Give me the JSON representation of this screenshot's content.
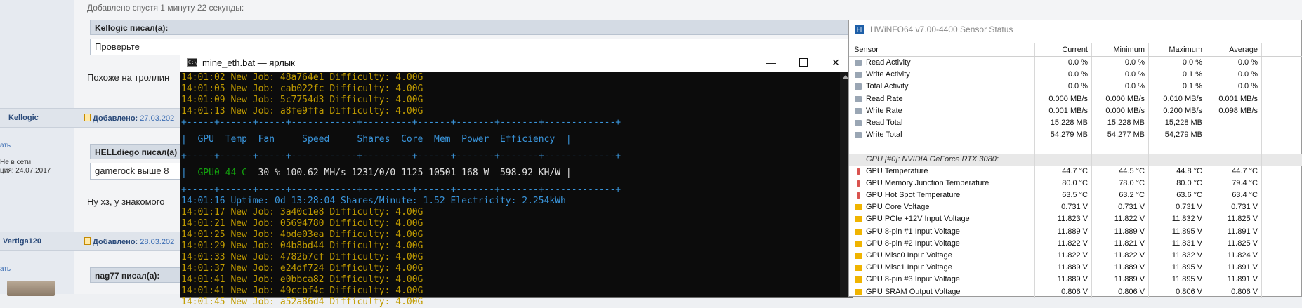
{
  "forum": {
    "added_top": "Добавлено спустя 1 минуту 22 секунды:",
    "quote1_author": "Kellogic писал(а):",
    "quote1_text": "Проверьте",
    "reply1_text": "Похоже на троллин",
    "post2_user": "Kellogic",
    "post2_added": "Добавлено:",
    "post2_date": "27.03.202",
    "post2_link": "ать",
    "post2_status": "Не в сети",
    "post2_reg": "ция: 24.07.2017",
    "quote2_author": "HELLdiego писал(а)",
    "quote2_text": "gamerock выше 8",
    "reply2_text": "Ну хз, у знакомого",
    "post3_user": "Vertiga120",
    "post3_added": "Добавлено:",
    "post3_date": "28.03.202",
    "post3_link": "ать",
    "quote3_author": "nag77 писал(а):"
  },
  "cmd": {
    "title": "mine_eth.bat — ярлык",
    "icon_label": "C:\\",
    "min_glyph": "—",
    "close_glyph": "✕",
    "lines_before": [
      "14:01:02 New Job: 48a764e1 Difficulty: 4.00G",
      "14:01:05 New Job: cab022fc Difficulty: 4.00G",
      "14:01:09 New Job: 5c7754d3 Difficulty: 4.00G",
      "14:01:13 New Job: a8fe9ffa Difficulty: 4.00G"
    ],
    "separator": "+-----+------+-----+------------+---------+------+-------+-------+-------------+",
    "header_row": "|  GPU  Temp  Fan     Speed     Shares  Core  Mem  Power  Efficiency  |",
    "gpu_row_prefix": "|  ",
    "gpu_row_name": "GPU0 44 C",
    "gpu_row_rest": "  30 % 100.62 MH/s 1231/0/0 1125 10501 168 W  598.92 KH/W |",
    "uptime": "14:01:16 Uptime: 0d 13:28:04 Shares/Minute: 1.52 Electricity: 2.254kWh",
    "lines_after": [
      "14:01:17 New Job: 3a40c1e8 Difficulty: 4.00G",
      "14:01:21 New Job: 05694780 Difficulty: 4.00G",
      "14:01:25 New Job: 4bde03ea Difficulty: 4.00G",
      "14:01:29 New Job: 04b8bd44 Difficulty: 4.00G",
      "14:01:33 New Job: 4782b7cf Difficulty: 4.00G",
      "14:01:37 New Job: e24df724 Difficulty: 4.00G",
      "14:01:41 New Job: e0bbca82 Difficulty: 4.00G",
      "14:01:41 New Job: 49ccbf4c Difficulty: 4.00G",
      "14:01:45 New Job: a52a86d4 Difficulty: 4.00G"
    ]
  },
  "hwinfo": {
    "title": "HWiNFO64 v7.00-4400 Sensor Status",
    "icon_label": "HI",
    "min_glyph": "—",
    "columns": [
      "Sensor",
      "Current",
      "Minimum",
      "Maximum",
      "Average"
    ],
    "rows": [
      {
        "name": "Read Activity",
        "cur": "0.0 %",
        "min": "0.0 %",
        "max": "0.0 %",
        "avg": "0.0 %",
        "icon": "disk"
      },
      {
        "name": "Write Activity",
        "cur": "0.0 %",
        "min": "0.0 %",
        "max": "0.1 %",
        "avg": "0.0 %",
        "icon": "disk"
      },
      {
        "name": "Total Activity",
        "cur": "0.0 %",
        "min": "0.0 %",
        "max": "0.1 %",
        "avg": "0.0 %",
        "icon": "disk"
      },
      {
        "name": "Read Rate",
        "cur": "0.000 MB/s",
        "min": "0.000 MB/s",
        "max": "0.010 MB/s",
        "avg": "0.001 MB/s",
        "icon": "disk"
      },
      {
        "name": "Write Rate",
        "cur": "0.001 MB/s",
        "min": "0.000 MB/s",
        "max": "0.200 MB/s",
        "avg": "0.098 MB/s",
        "icon": "disk"
      },
      {
        "name": "Read Total",
        "cur": "15,228 MB",
        "min": "15,228 MB",
        "max": "15,228 MB",
        "avg": "",
        "icon": "disk"
      },
      {
        "name": "Write Total",
        "cur": "54,279 MB",
        "min": "54,277 MB",
        "max": "54,279 MB",
        "avg": "",
        "icon": "disk"
      },
      {
        "name": "",
        "cur": "",
        "min": "",
        "max": "",
        "avg": "",
        "icon": ""
      },
      {
        "name": "GPU [#0]: NVIDIA GeForce RTX 3080:",
        "cur": "",
        "min": "",
        "max": "",
        "avg": "",
        "icon": "section"
      },
      {
        "name": "GPU Temperature",
        "cur": "44.7 °C",
        "min": "44.5 °C",
        "max": "44.8 °C",
        "avg": "44.7 °C",
        "icon": "temp"
      },
      {
        "name": "GPU Memory Junction Temperature",
        "cur": "80.0 °C",
        "min": "78.0 °C",
        "max": "80.0 °C",
        "avg": "79.4 °C",
        "icon": "temp"
      },
      {
        "name": "GPU Hot Spot Temperature",
        "cur": "63.5 °C",
        "min": "63.2 °C",
        "max": "63.6 °C",
        "avg": "63.4 °C",
        "icon": "temp"
      },
      {
        "name": "GPU Core Voltage",
        "cur": "0.731 V",
        "min": "0.731 V",
        "max": "0.731 V",
        "avg": "0.731 V",
        "icon": "volt"
      },
      {
        "name": "GPU PCIe +12V Input Voltage",
        "cur": "11.823 V",
        "min": "11.822 V",
        "max": "11.832 V",
        "avg": "11.825 V",
        "icon": "volt"
      },
      {
        "name": "GPU 8-pin #1 Input Voltage",
        "cur": "11.889 V",
        "min": "11.889 V",
        "max": "11.895 V",
        "avg": "11.891 V",
        "icon": "volt"
      },
      {
        "name": "GPU 8-pin #2 Input Voltage",
        "cur": "11.822 V",
        "min": "11.821 V",
        "max": "11.831 V",
        "avg": "11.825 V",
        "icon": "volt"
      },
      {
        "name": "GPU Misc0 Input Voltage",
        "cur": "11.822 V",
        "min": "11.822 V",
        "max": "11.832 V",
        "avg": "11.824 V",
        "icon": "volt"
      },
      {
        "name": "GPU Misc1 Input Voltage",
        "cur": "11.889 V",
        "min": "11.889 V",
        "max": "11.895 V",
        "avg": "11.891 V",
        "icon": "volt"
      },
      {
        "name": "GPU 8-pin #3 Input Voltage",
        "cur": "11.889 V",
        "min": "11.889 V",
        "max": "11.895 V",
        "avg": "11.891 V",
        "icon": "volt"
      },
      {
        "name": "GPU SRAM Output Voltage",
        "cur": "0.806 V",
        "min": "0.806 V",
        "max": "0.806 V",
        "avg": "0.806 V",
        "icon": "volt"
      }
    ]
  }
}
